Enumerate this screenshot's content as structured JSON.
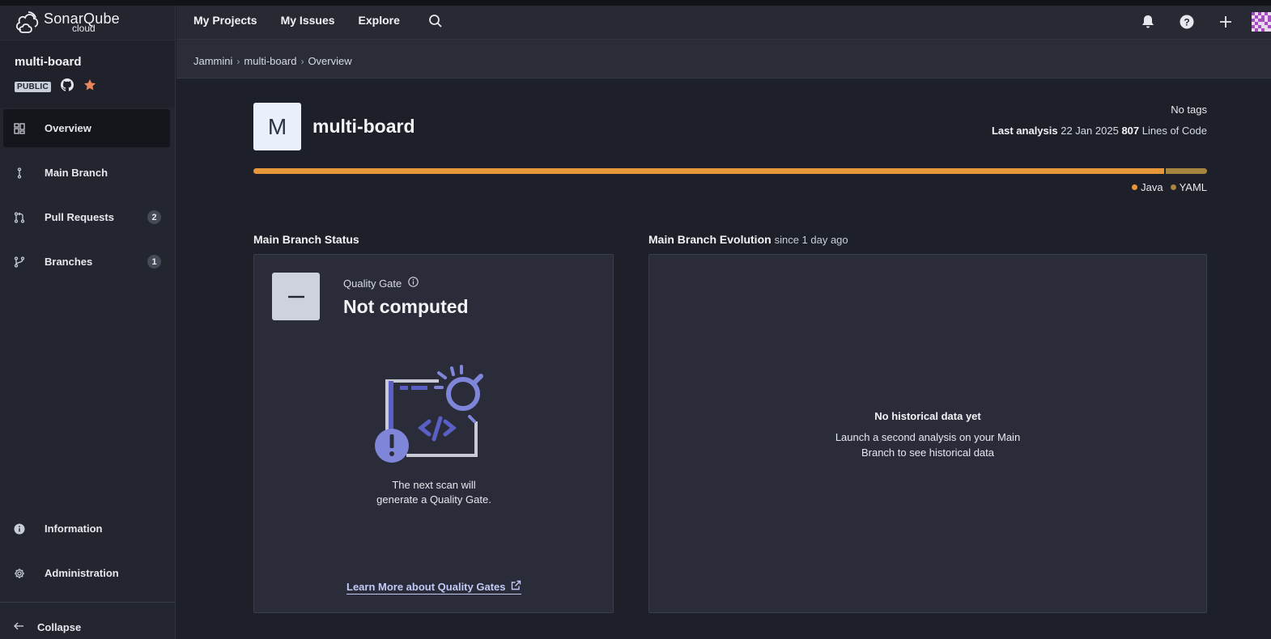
{
  "app": {
    "logo_line1": "SonarQube",
    "logo_line2": "cloud"
  },
  "sidebar": {
    "project_name": "multi-board",
    "visibility": "PUBLIC",
    "items": [
      {
        "label": "Overview",
        "icon": "overview-icon",
        "active": true
      },
      {
        "label": "Main Branch",
        "icon": "branch-icon"
      },
      {
        "label": "Pull Requests",
        "icon": "pull-request-icon",
        "count": "2"
      },
      {
        "label": "Branches",
        "icon": "branches-icon",
        "count": "1"
      }
    ],
    "bottom_items": [
      {
        "label": "Information",
        "icon": "info-icon"
      },
      {
        "label": "Administration",
        "icon": "gear-icon"
      }
    ],
    "collapse_label": "Collapse"
  },
  "topnav": {
    "items": [
      "My Projects",
      "My Issues",
      "Explore"
    ]
  },
  "breadcrumb": [
    "Jammini",
    "multi-board",
    "Overview"
  ],
  "project": {
    "initial": "M",
    "title": "multi-board",
    "tags": "No tags",
    "last_analysis_label": "Last analysis",
    "last_analysis_date": "22 Jan 2025",
    "loc_value": "807",
    "loc_label": "Lines of Code"
  },
  "languages": [
    {
      "name": "Java",
      "share": 0.955,
      "color": "#e8963a"
    },
    {
      "name": "YAML",
      "share": 0.045,
      "color": "#a7843f"
    }
  ],
  "status": {
    "section_title": "Main Branch Status",
    "qg_label": "Quality Gate",
    "qg_value": "Not computed",
    "qg_symbol": "–",
    "qg_message": "The next scan will generate a Quality Gate.",
    "learn_more": "Learn More about Quality Gates"
  },
  "evolution": {
    "section_title": "Main Branch Evolution",
    "since": "since 1 day ago",
    "empty_title": "No historical data yet",
    "empty_message": "Launch a second analysis on your Main Branch to see historical data"
  }
}
